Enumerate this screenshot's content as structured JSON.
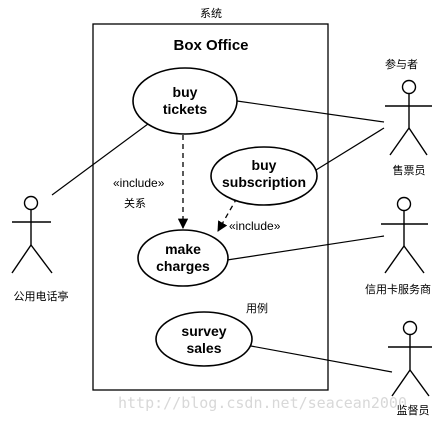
{
  "annotations": {
    "system": "系统",
    "actor": "参与者",
    "relationship": "关系",
    "use_case": "用例"
  },
  "system": {
    "title": "Box Office"
  },
  "use_cases": {
    "buy_tickets": {
      "line1": "buy",
      "line2": "tickets"
    },
    "buy_subscription": {
      "line1": "buy",
      "line2": "subscription"
    },
    "make_charges": {
      "line1": "make",
      "line2": "charges"
    },
    "survey_sales": {
      "line1": "survey",
      "line2": "sales"
    }
  },
  "relationships": {
    "include_1": "«include»",
    "include_2": "«include»"
  },
  "actors": {
    "public_phone": "公用电话亭",
    "clerk": "售票员",
    "credit_card_service": "信用卡服务商",
    "supervisor": "监督员"
  },
  "watermark": "http://blog.csdn.net/seacean2000"
}
